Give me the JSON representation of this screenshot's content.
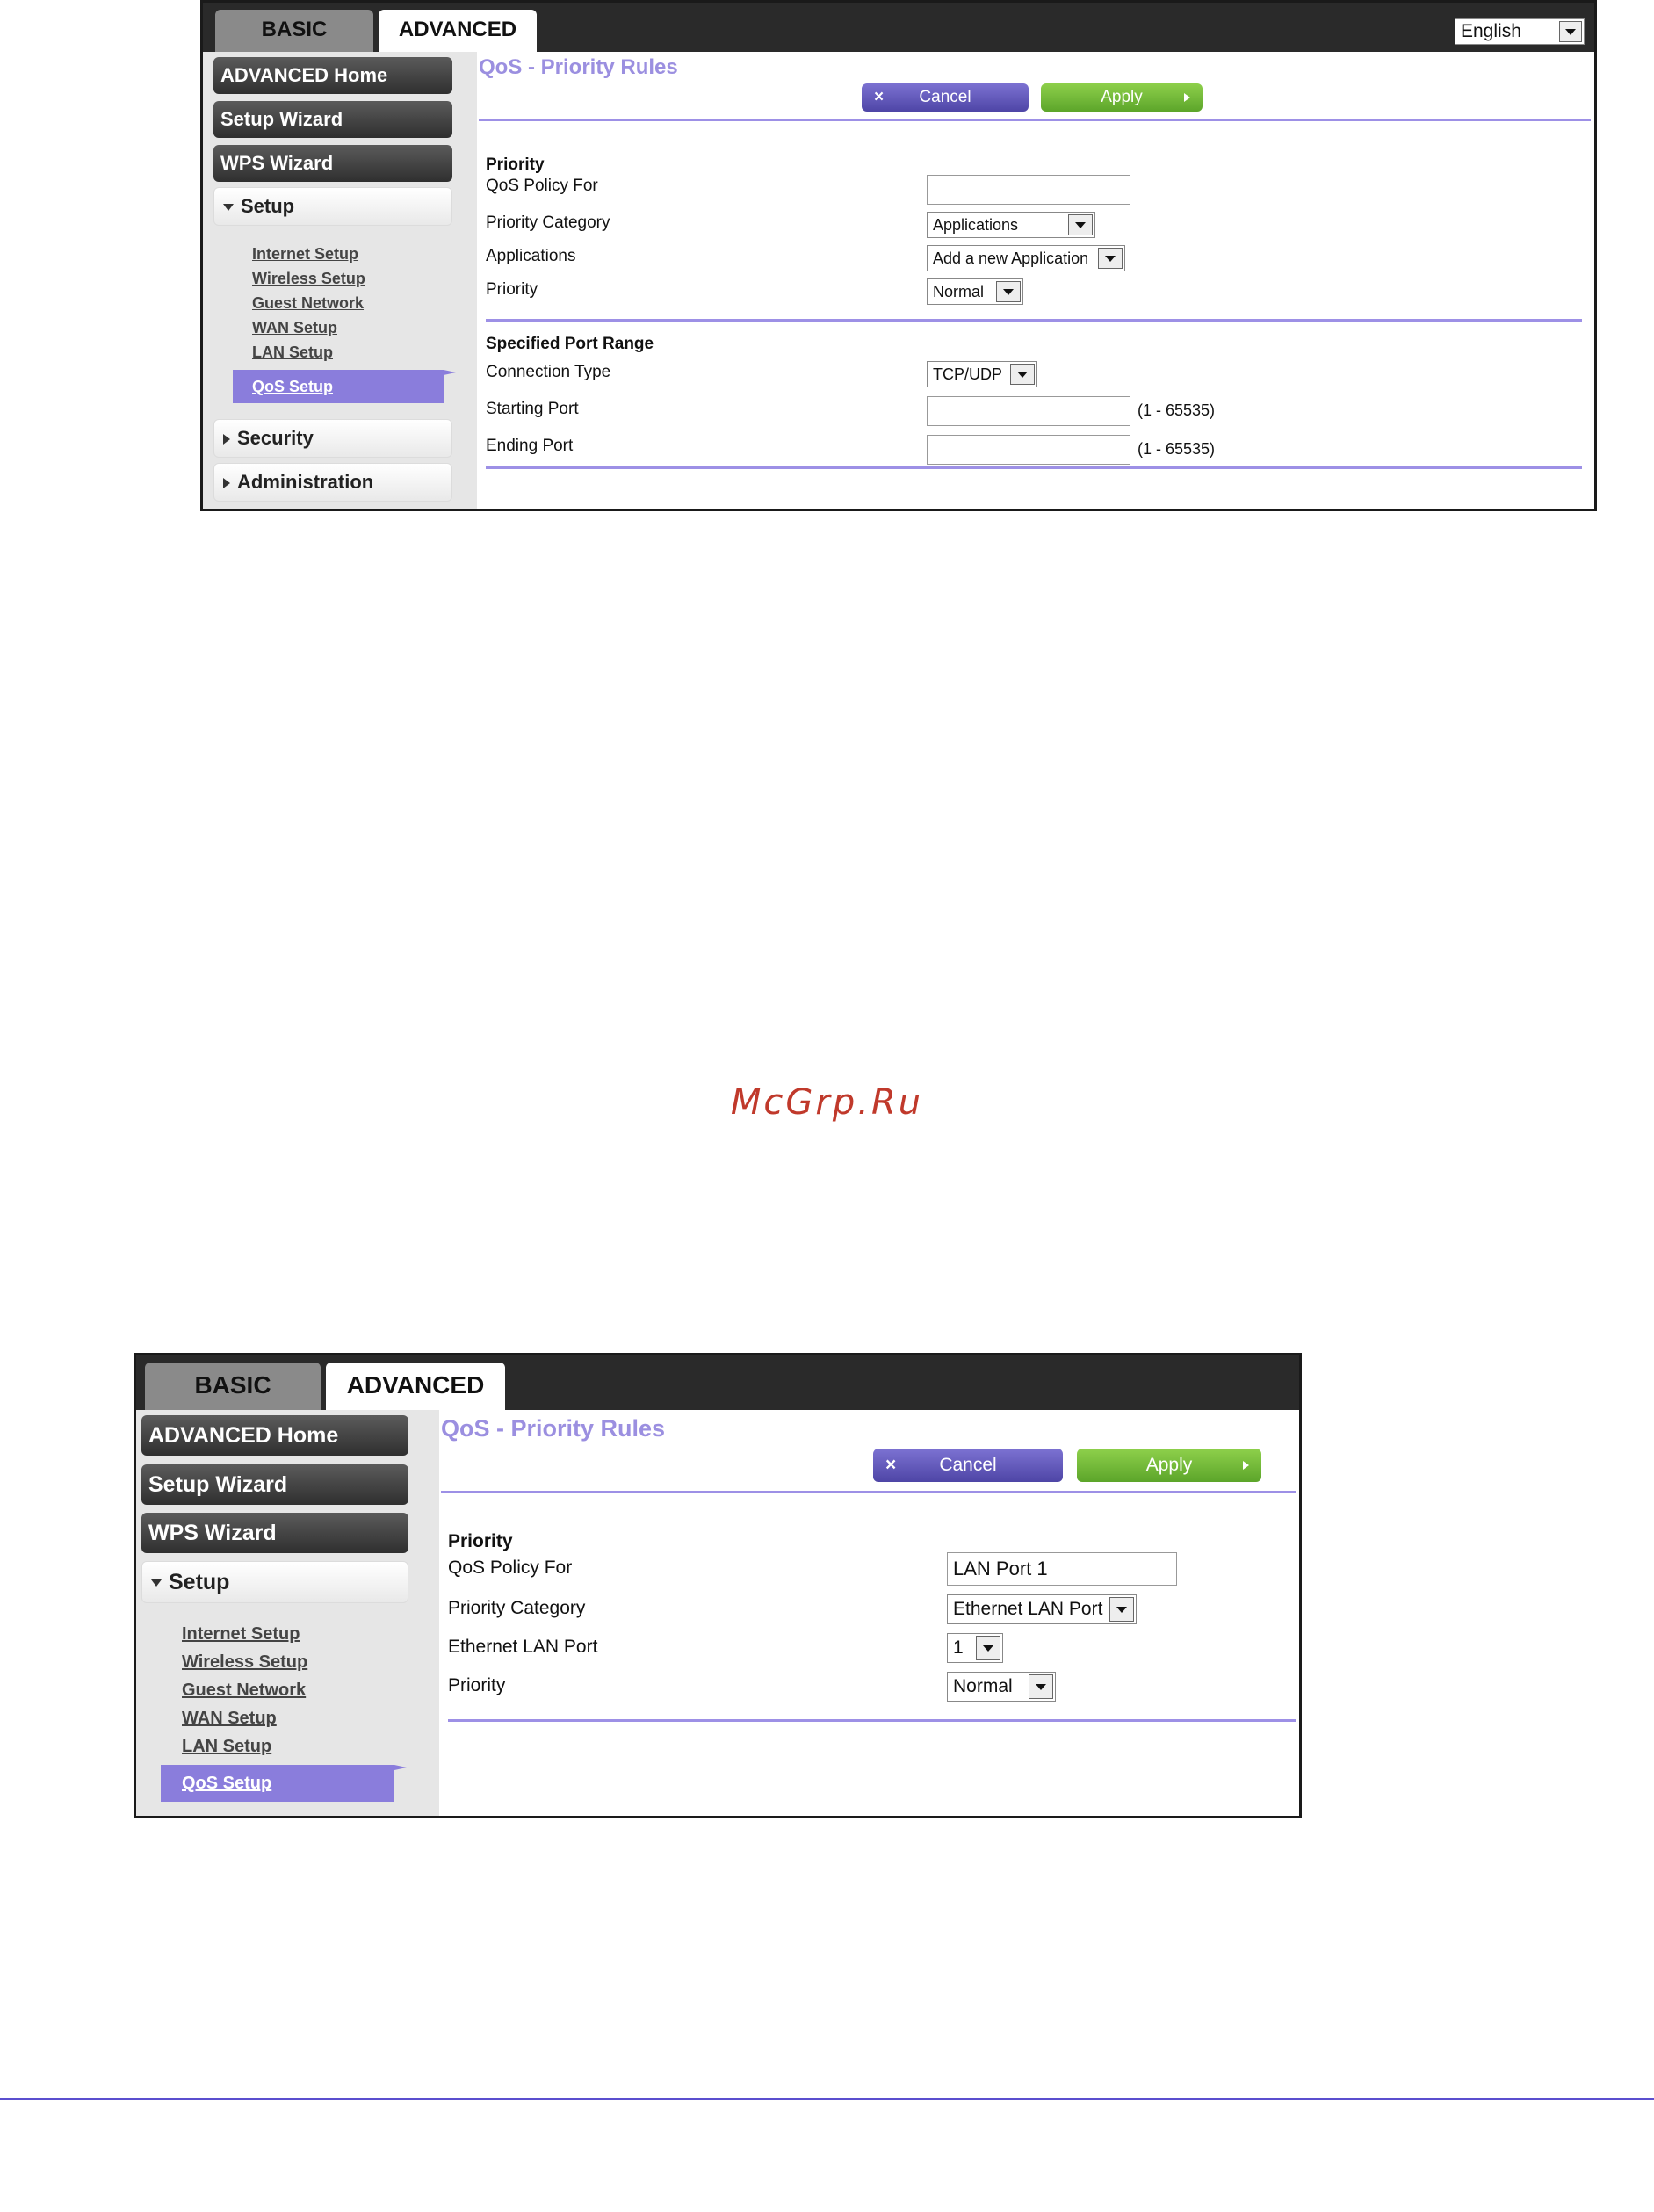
{
  "screenshots": [
    {
      "tabs": {
        "basic": "BASIC",
        "advanced": "ADVANCED"
      },
      "language": "English",
      "sidebar": {
        "advanced_home": "ADVANCED Home",
        "setup_wizard": "Setup Wizard",
        "wps_wizard": "WPS Wizard",
        "setup": "Setup",
        "links": [
          "Internet Setup",
          "Wireless Setup",
          "Guest Network",
          "WAN Setup",
          "LAN Setup"
        ],
        "active": "QoS Setup",
        "security": "Security",
        "administration": "Administration"
      },
      "main": {
        "title": "QoS - Priority Rules",
        "cancel": "Cancel",
        "apply": "Apply",
        "priority_heading": "Priority",
        "qos_policy_for_label": "QoS Policy For",
        "qos_policy_for_value": "",
        "priority_category_label": "Priority Category",
        "priority_category_value": "Applications",
        "applications_label": "Applications",
        "applications_value": "Add a new Application",
        "priority_label": "Priority",
        "priority_value": "Normal",
        "port_range_heading": "Specified Port Range",
        "connection_type_label": "Connection Type",
        "connection_type_value": "TCP/UDP",
        "starting_port_label": "Starting Port",
        "starting_port_value": "",
        "starting_port_range": "(1 - 65535)",
        "ending_port_label": "Ending Port",
        "ending_port_value": "",
        "ending_port_range": "(1 - 65535)"
      }
    },
    {
      "tabs": {
        "basic": "BASIC",
        "advanced": "ADVANCED"
      },
      "sidebar": {
        "advanced_home": "ADVANCED Home",
        "setup_wizard": "Setup Wizard",
        "wps_wizard": "WPS Wizard",
        "setup": "Setup",
        "links": [
          "Internet Setup",
          "Wireless Setup",
          "Guest Network",
          "WAN Setup",
          "LAN Setup"
        ],
        "active": "QoS Setup"
      },
      "main": {
        "title": "QoS - Priority Rules",
        "cancel": "Cancel",
        "apply": "Apply",
        "priority_heading": "Priority",
        "qos_policy_for_label": "QoS Policy For",
        "qos_policy_for_value": "LAN Port 1",
        "priority_category_label": "Priority Category",
        "priority_category_value": "Ethernet LAN Port",
        "lan_port_label": "Ethernet LAN Port",
        "lan_port_value": "1",
        "priority_label": "Priority",
        "priority_value": "Normal"
      }
    }
  ],
  "watermark": "McGrp.Ru",
  "colors": {
    "accent": "#9d90e6",
    "active_nav": "#8a7ddc",
    "apply": "#6fba35",
    "cancel": "#5d54b8"
  },
  "icons": [
    "dropdown-arrow-icon",
    "close-icon",
    "arrow-right-icon",
    "triangle-down-icon",
    "triangle-right-icon"
  ]
}
